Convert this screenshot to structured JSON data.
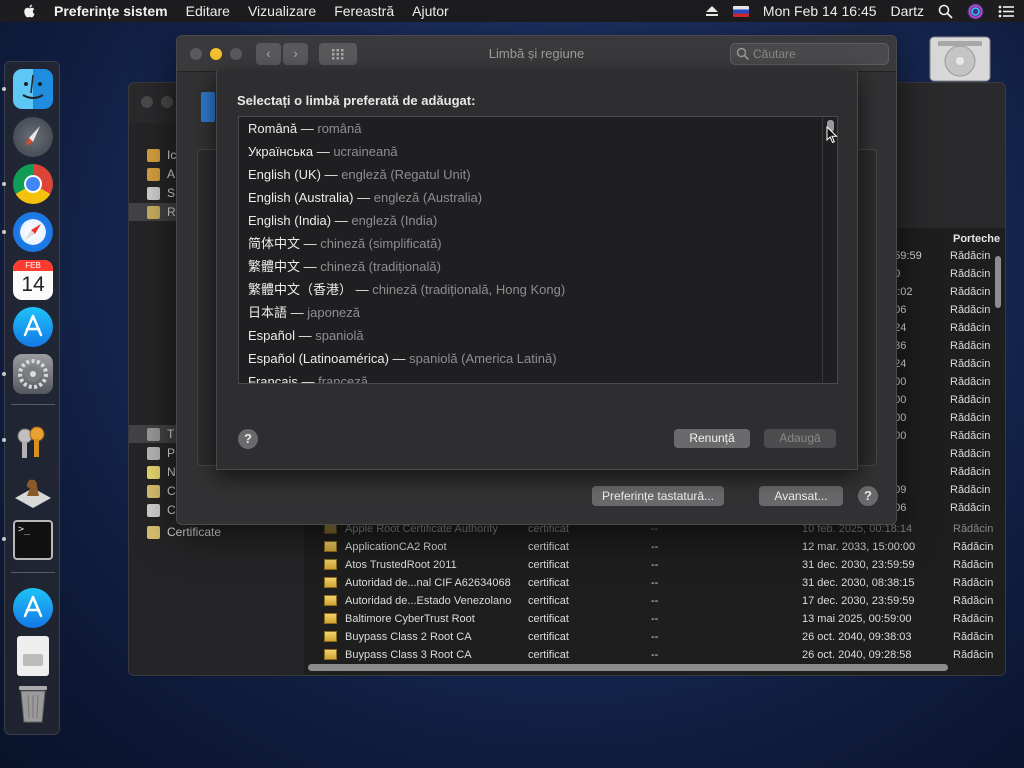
{
  "menubar": {
    "app_name": "Preferințe sistem",
    "menus": [
      "Editare",
      "Vizualizare",
      "Fereastră",
      "Ajutor"
    ],
    "clock": "Mon Feb 14  16:45",
    "user": "Dartz"
  },
  "dock": {
    "icons": [
      "finder-icon",
      "launchpad-icon",
      "chrome-icon",
      "safari-icon",
      "calendar-icon",
      "app-store-icon",
      "system-preferences-icon",
      "keychain-access-icon",
      "chess-icon",
      "terminal-icon",
      "app-store-downloads-icon",
      "document-icon",
      "trash-icon"
    ],
    "calendar_month": "FEB",
    "calendar_day": "14"
  },
  "front_window": {
    "title": "Limbă și regiune",
    "search_placeholder": "Căutare",
    "keyboard_prefs_label": "Preferințe tastatură...",
    "advanced_label": "Avansat...",
    "help_label": "?"
  },
  "sheet": {
    "title": "Selectați o limbă preferată de adăugat:",
    "cancel_label": "Renunță",
    "add_label": "Adaugă",
    "help_label": "?",
    "languages": [
      {
        "native": "Română",
        "romanian": "română"
      },
      {
        "native": "Українська",
        "romanian": "ucraineană"
      },
      {
        "native": "English (UK)",
        "romanian": "engleză (Regatul Unit)"
      },
      {
        "native": "English (Australia)",
        "romanian": "engleză (Australia)"
      },
      {
        "native": "English (India)",
        "romanian": "engleză (India)"
      },
      {
        "native": "简体中文",
        "romanian": "chineză (simplificată)"
      },
      {
        "native": "繁體中文",
        "romanian": "chineză (tradițională)"
      },
      {
        "native": "繁體中文（香港）",
        "romanian": "chineză (tradițională, Hong Kong)"
      },
      {
        "native": "日本語",
        "romanian": "japoneză"
      },
      {
        "native": "Español",
        "romanian": "spaniolă"
      },
      {
        "native": "Español (Latinoamérica)",
        "romanian": "spaniolă (America Latină)"
      },
      {
        "native": "Français",
        "romanian": "franceză"
      }
    ]
  },
  "back_window": {
    "sidebar_top": [
      {
        "label": "Ic",
        "selected": false
      },
      {
        "label": "A",
        "selected": false
      },
      {
        "label": "S",
        "selected": false
      },
      {
        "label": "R",
        "selected": true
      }
    ],
    "sidebar_bottom": [
      {
        "label": "T",
        "selected": true
      },
      {
        "label": "P",
        "selected": false
      },
      {
        "label": "N",
        "selected": false
      },
      {
        "label": "C",
        "selected": false
      },
      {
        "label": "C",
        "selected": false
      },
      {
        "label": "Certificate",
        "selected": false
      }
    ],
    "column_header_right": "Porteche",
    "right_time_fragments": [
      "5:59:59",
      ":00",
      "22:02",
      "6:06",
      "8:24",
      "0:36",
      "0:24",
      "0:00",
      "0:00",
      "0:00",
      "0:00",
      "38",
      "36",
      "0:09",
      "9:06"
    ],
    "right_column_value": "Rădăcin",
    "rows": [
      {
        "name": "Apple Root Certificate Authority",
        "kind": "certificat",
        "dash": "--",
        "expires": "10 feb. 2025, 00:18:14",
        "keychain": "Rădăcin"
      },
      {
        "name": "ApplicationCA2 Root",
        "kind": "certificat",
        "dash": "--",
        "expires": "12 mar. 2033, 15:00:00",
        "keychain": "Rădăcin"
      },
      {
        "name": "Atos TrustedRoot 2011",
        "kind": "certificat",
        "dash": "--",
        "expires": "31 dec. 2030, 23:59:59",
        "keychain": "Rădăcin"
      },
      {
        "name": "Autoridad de...nal CIF A62634068",
        "kind": "certificat",
        "dash": "--",
        "expires": "31 dec. 2030, 08:38:15",
        "keychain": "Rădăcin"
      },
      {
        "name": "Autoridad de...Estado Venezolano",
        "kind": "certificat",
        "dash": "--",
        "expires": "17 dec. 2030, 23:59:59",
        "keychain": "Rădăcin"
      },
      {
        "name": "Baltimore CyberTrust Root",
        "kind": "certificat",
        "dash": "--",
        "expires": "13 mai 2025, 00:59:00",
        "keychain": "Rădăcin"
      },
      {
        "name": "Buypass Class 2 Root CA",
        "kind": "certificat",
        "dash": "--",
        "expires": "26 oct. 2040, 09:38:03",
        "keychain": "Rădăcin"
      },
      {
        "name": "Buypass Class 3 Root CA",
        "kind": "certificat",
        "dash": "--",
        "expires": "26 oct. 2040, 09:28:58",
        "keychain": "Rădăcin"
      }
    ]
  }
}
